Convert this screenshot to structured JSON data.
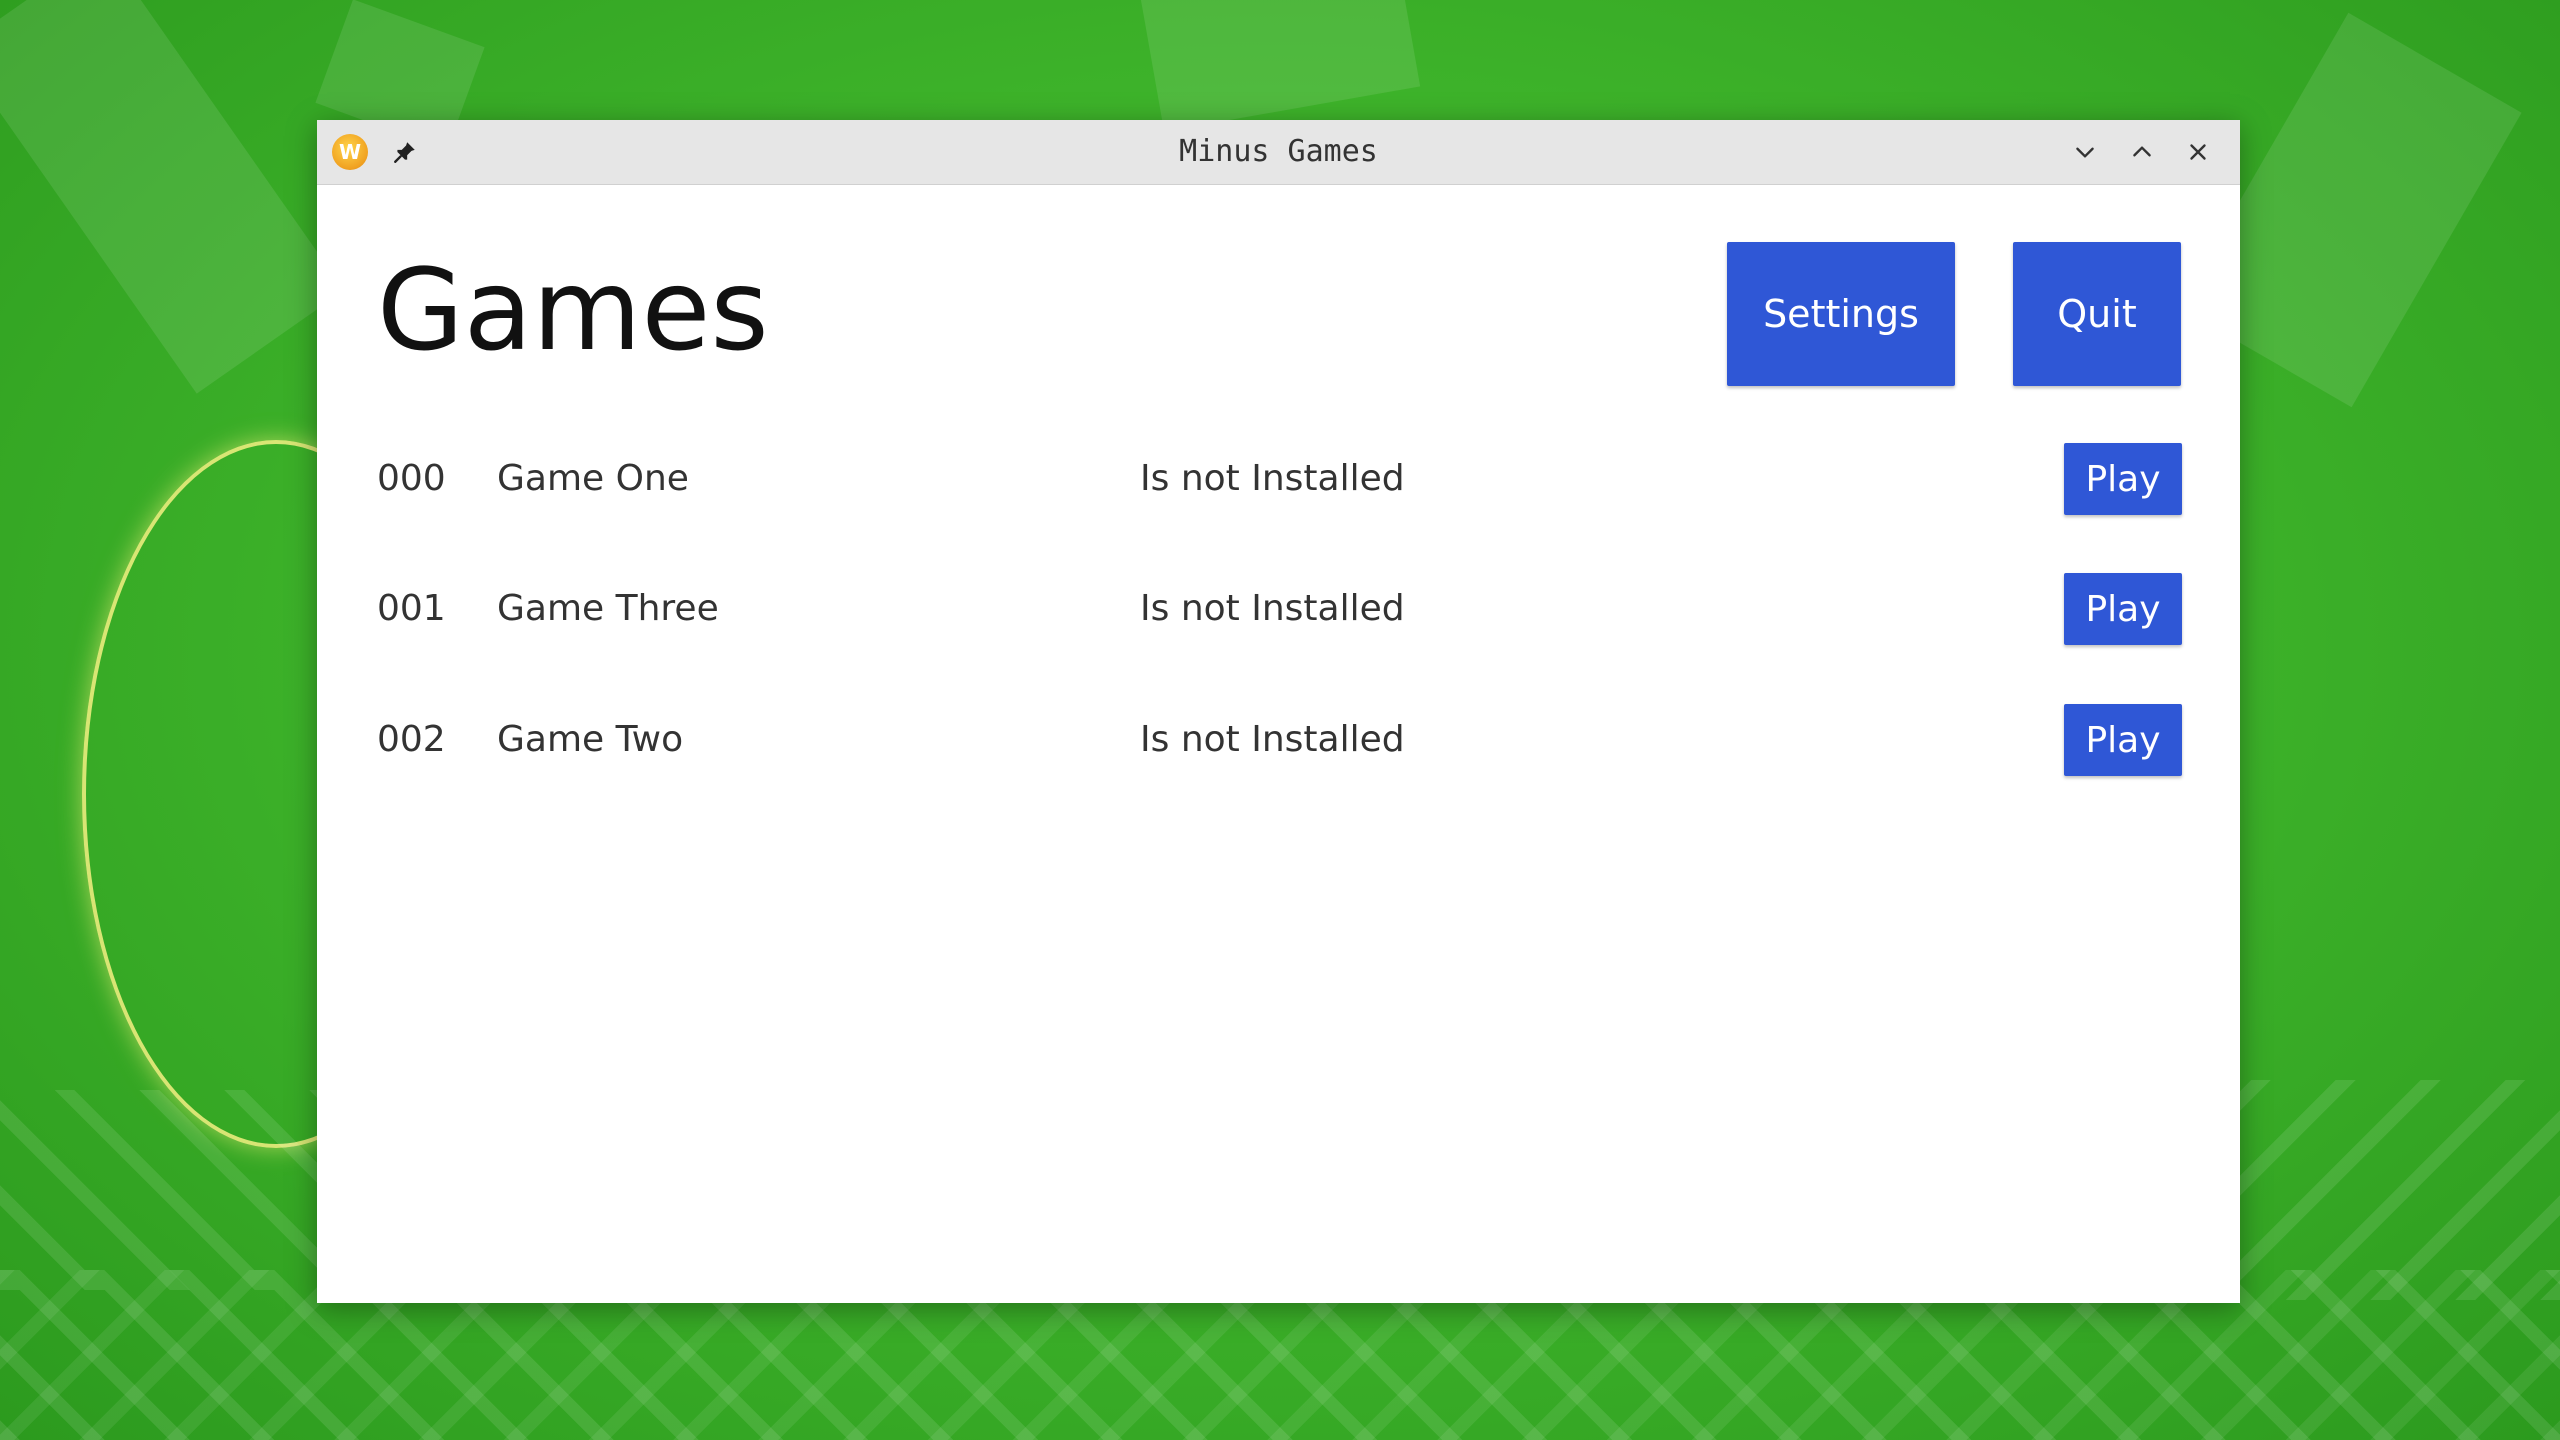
{
  "window": {
    "title": "Minus Games",
    "app_icon_glyph": "W"
  },
  "header": {
    "title": "Games",
    "settings_label": "Settings",
    "quit_label": "Quit"
  },
  "games": [
    {
      "id": "000",
      "name": "Game One",
      "status": "Is not Installed",
      "action": "Play"
    },
    {
      "id": "001",
      "name": "Game Three",
      "status": "Is not Installed",
      "action": "Play"
    },
    {
      "id": "002",
      "name": "Game Two",
      "status": "Is not Installed",
      "action": "Play"
    }
  ],
  "colors": {
    "accent": "#2f57d6",
    "desktop": "#3fb52b"
  },
  "icons": {
    "app": "app-icon",
    "pin": "pin-icon",
    "minimize": "chevron-down-icon",
    "maximize": "chevron-up-icon",
    "close": "close-icon"
  }
}
